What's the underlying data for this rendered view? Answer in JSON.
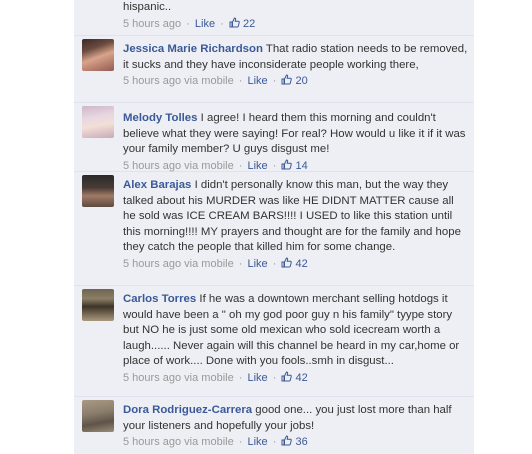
{
  "comments": [
    {
      "text": "hispanic..",
      "author": "",
      "time": "5 hours ago",
      "via": "",
      "like": "Like",
      "likes": "22"
    },
    {
      "author": "Jessica Marie Richardson",
      "text": "That radio station needs to be removed, it sucks and they have inconsiderate people working there,",
      "time": "5 hours ago",
      "via": "via mobile",
      "like": "Like",
      "likes": "20",
      "avatar": "photo"
    },
    {
      "author": "Melody Tolles",
      "text": "I agree! I heard them this morning and couldn't believe what they were saying! For real? How would u like it if it was your family member? U guys disgust me!",
      "time": "5 hours ago",
      "via": "via mobile",
      "like": "Like",
      "likes": "14",
      "avatar": "photo"
    },
    {
      "author": "Alex Barajas",
      "text": "I didn't personally know this man, but the way they talked about his MURDER was like HE DIDNT MATTER cause all he sold was ICE CREAM BARS!!!! I USED to like this station until this morning!!!! MY prayers and thought are for the family and hope they catch the people that killed him for some change.",
      "time": "5 hours ago",
      "via": "via mobile",
      "like": "Like",
      "likes": "42",
      "avatar": "photo"
    },
    {
      "author": "Carlos Torres",
      "text": "If he was a downtown merchant selling hotdogs it would have been a \" oh my god poor guy n his family\" tyype story but NO he is just some old mexican who sold icecream worth a laugh...... Never again will this channel be heard in my car,home or place of work.... Done with you fools..smh in disgust...",
      "time": "5 hours ago",
      "via": "via mobile",
      "like": "Like",
      "likes": "42",
      "avatar": "photo"
    },
    {
      "author": "Dora Rodriguez-Carrera",
      "text": "good one... you just lost more than half your listeners and hopefully your jobs!",
      "time": "5 hours ago",
      "via": "via mobile",
      "like": "Like",
      "likes": "36",
      "avatar": "photo"
    }
  ],
  "colors": {
    "link": "#3b5998",
    "meta": "#999999",
    "text": "#333333",
    "background": "#edeff4"
  },
  "icons": {
    "like_count": "thumbs-up-icon"
  }
}
